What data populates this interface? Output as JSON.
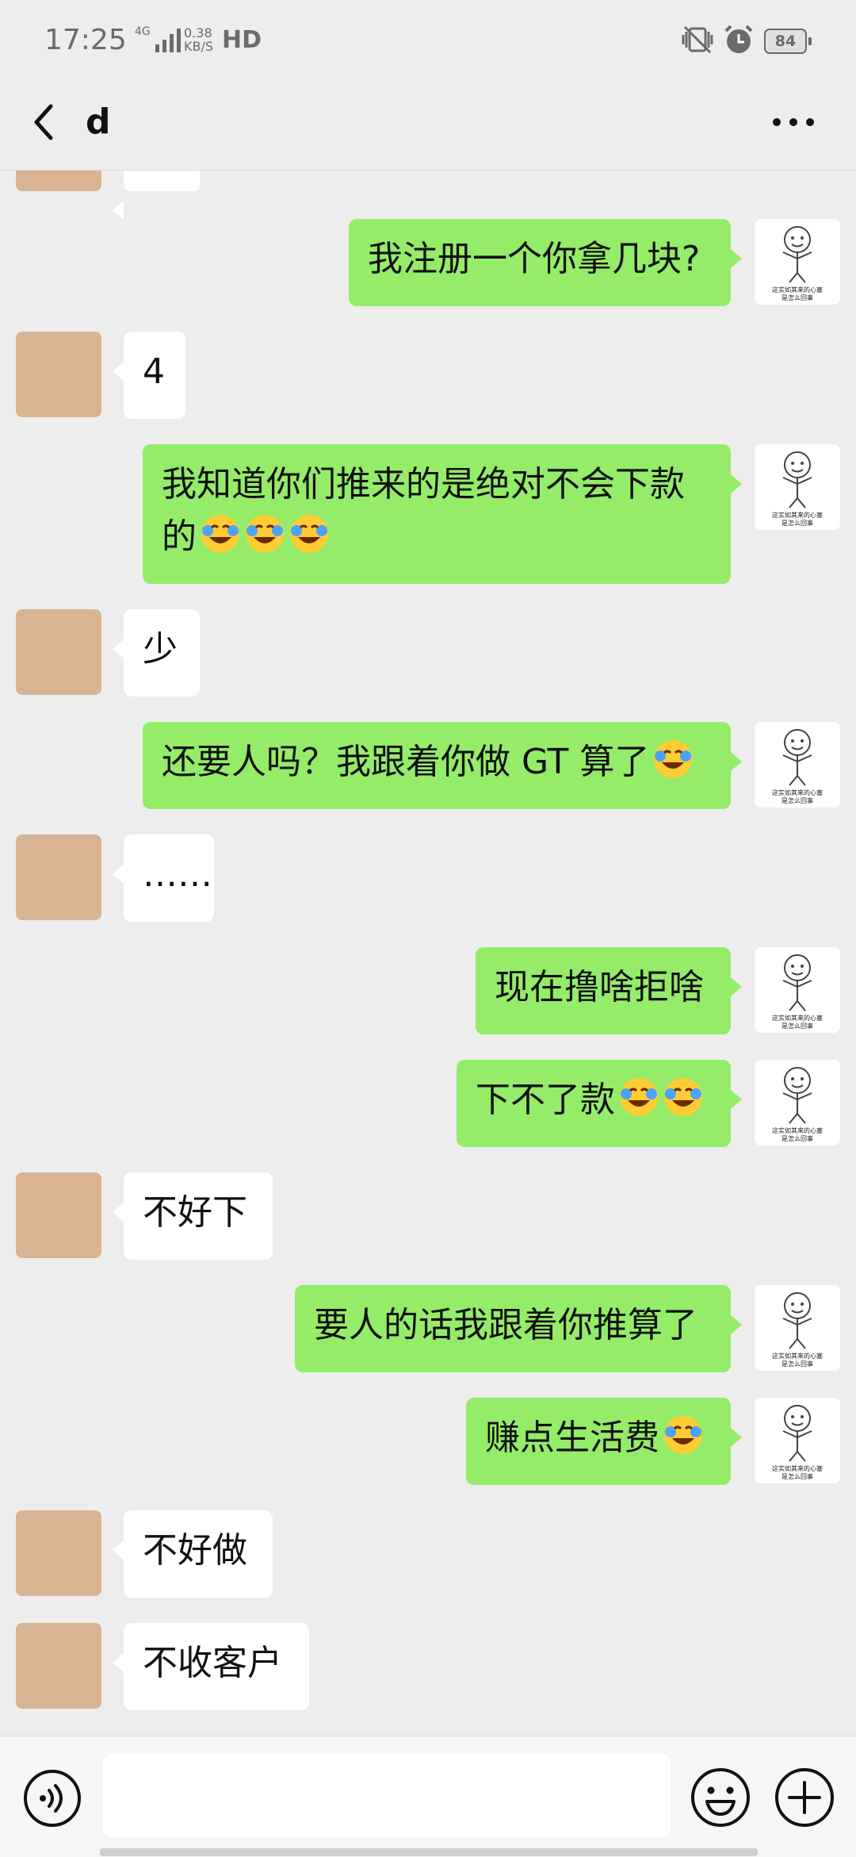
{
  "status_bar": {
    "time": "17:25",
    "network": "4G",
    "speed_value": "0.38",
    "speed_unit": "KB/S",
    "hd": "HD",
    "battery": "84"
  },
  "header": {
    "title": "d"
  },
  "messages": [
    {
      "from": "me",
      "text": "我注册一个你拿几块?"
    },
    {
      "from": "her",
      "text": "4"
    },
    {
      "from": "me",
      "text": "我知道你们推来的是绝对不会下款的",
      "emoji": "joy-tears-emoji x3"
    },
    {
      "from": "her",
      "text": "少"
    },
    {
      "from": "me",
      "text": "还要人吗？我跟着你做 GT 算了",
      "emoji": "joy-tears-emoji"
    },
    {
      "from": "her",
      "text": "……"
    },
    {
      "from": "me",
      "text": "现在撸啥拒啥"
    },
    {
      "from": "me",
      "text": "下不了款",
      "emoji": "joy-tears-emoji x2"
    },
    {
      "from": "her",
      "text": "不好下"
    },
    {
      "from": "me",
      "text": "要人的话我跟着你推算了"
    },
    {
      "from": "me",
      "text": "赚点生活费",
      "emoji": "joy-tears-emoji"
    },
    {
      "from": "her",
      "text": "不好做"
    },
    {
      "from": "her",
      "text": "不收客户"
    }
  ],
  "sticker_avatar_caption": "这实如其来的心塞是怎么回事",
  "input": {
    "value": ""
  },
  "icons": {
    "back": "chevron-left-icon",
    "more": "more-dots-icon",
    "voice": "voice-icon",
    "emoji": "smiley-icon",
    "plus": "plus-icon"
  },
  "colors": {
    "outgoing_bubble": "#95ec69",
    "incoming_bubble": "#ffffff",
    "background": "#ededed"
  }
}
